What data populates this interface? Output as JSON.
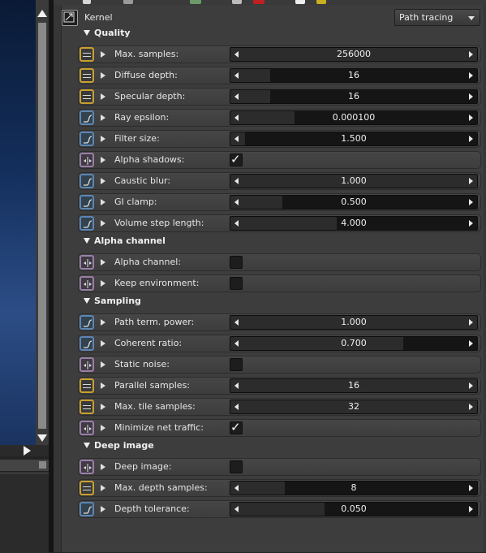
{
  "header": {
    "title": "Kernel",
    "mode": "Path tracing"
  },
  "sections": [
    {
      "title": "Quality",
      "rows": [
        {
          "label": "Max. samples:",
          "kind": "int",
          "value": "256000",
          "fill_fraction": 1.0
        },
        {
          "label": "Diffuse depth:",
          "kind": "int",
          "value": "16",
          "fill_fraction": 0.16
        },
        {
          "label": "Specular depth:",
          "kind": "int",
          "value": "16",
          "fill_fraction": 0.16
        },
        {
          "label": "Ray epsilon:",
          "kind": "float",
          "value": "0.000100",
          "fill_fraction": 0.26
        },
        {
          "label": "Filter size:",
          "kind": "float",
          "value": "1.500",
          "fill_fraction": 0.06
        },
        {
          "label": "Alpha shadows:",
          "kind": "bool",
          "checked": true
        },
        {
          "label": "Caustic blur:",
          "kind": "float",
          "value": "1.000",
          "fill_fraction": 1.0
        },
        {
          "label": "GI clamp:",
          "kind": "float",
          "value": "0.500",
          "fill_fraction": 0.21
        },
        {
          "label": "Volume step length:",
          "kind": "float",
          "value": "4.000",
          "fill_fraction": 0.43
        }
      ]
    },
    {
      "title": "Alpha channel",
      "rows": [
        {
          "label": "Alpha channel:",
          "kind": "bool",
          "checked": false
        },
        {
          "label": "Keep environment:",
          "kind": "bool",
          "checked": false
        }
      ]
    },
    {
      "title": "Sampling",
      "rows": [
        {
          "label": "Path term. power:",
          "kind": "float",
          "value": "1.000",
          "fill_fraction": 1.0
        },
        {
          "label": "Coherent ratio:",
          "kind": "float",
          "value": "0.700",
          "fill_fraction": 0.7
        },
        {
          "label": "Static noise:",
          "kind": "bool",
          "checked": false
        },
        {
          "label": "Parallel samples:",
          "kind": "int",
          "value": "16",
          "fill_fraction": 1.0
        },
        {
          "label": "Max. tile samples:",
          "kind": "int",
          "value": "32",
          "fill_fraction": 1.0
        },
        {
          "label": "Minimize net traffic:",
          "kind": "bool",
          "checked": true
        }
      ]
    },
    {
      "title": "Deep image",
      "rows": [
        {
          "label": "Deep image:",
          "kind": "bool",
          "checked": false
        },
        {
          "label": "Max. depth samples:",
          "kind": "int",
          "value": "8",
          "fill_fraction": 0.22
        },
        {
          "label": "Depth tolerance:",
          "kind": "float",
          "value": "0.050",
          "fill_fraction": 0.38
        }
      ]
    }
  ],
  "checkmark": "✓",
  "colors": {
    "int_icon": "#c8a030",
    "float_icon": "#5b86b3",
    "bool_icon": "#9a7ea8",
    "viewport": "#1e3c70"
  }
}
